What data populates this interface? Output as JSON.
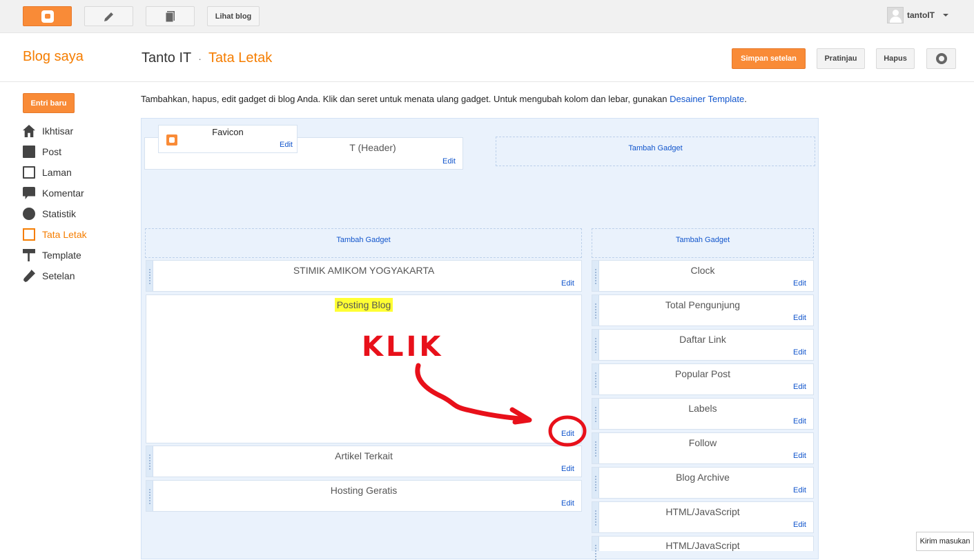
{
  "topbar": {
    "view_blog": "Lihat blog",
    "user_name": "tantoIT",
    "icons": [
      "blogger-logo-icon",
      "pencil-icon",
      "pages-icon",
      "avatar-icon",
      "caret-down-icon"
    ]
  },
  "header": {
    "my_blog": "Blog saya",
    "blog_name": "Tanto IT",
    "separator": "·",
    "section": "Tata Letak",
    "save_btn": "Simpan setelan",
    "preview_btn": "Pratinjau",
    "delete_btn": "Hapus"
  },
  "sidebar": {
    "new_post": "Entri baru",
    "items": [
      {
        "label": "Ikhtisar",
        "icon": "home-icon"
      },
      {
        "label": "Post",
        "icon": "post-icon"
      },
      {
        "label": "Laman",
        "icon": "page-icon"
      },
      {
        "label": "Komentar",
        "icon": "comment-icon"
      },
      {
        "label": "Statistik",
        "icon": "stats-icon"
      },
      {
        "label": "Tata Letak",
        "icon": "layout-icon",
        "active": true
      },
      {
        "label": "Template",
        "icon": "template-icon"
      },
      {
        "label": "Setelan",
        "icon": "settings-icon"
      }
    ]
  },
  "main": {
    "intro": "Tambahkan, hapus, edit gadget di blog Anda. Klik dan seret untuk menata ulang gadget. Untuk mengubah kolom dan lebar, gunakan ",
    "intro_link": "Desainer Template",
    "intro_end": ".",
    "edit": "Edit",
    "add_gadget": "Tambah Gadget",
    "favicon_title": "Favicon",
    "header_gadget": "T (Header)",
    "main_gadgets": [
      "STIMIK AMIKOM YOGYAKARTA",
      "Posting Blog",
      "Artikel Terkait",
      "Hosting Geratis"
    ],
    "side_gadgets": [
      "Clock",
      "Total Pengunjung",
      "Daftar Link",
      "Popular Post",
      "Labels",
      "Follow",
      "Blog Archive",
      "HTML/JavaScript",
      "HTML/JavaScript"
    ],
    "annotation": "KLIK"
  },
  "feedback": "Kirim masukan",
  "colors": {
    "accent": "#f98b37",
    "link": "#1155cc",
    "annotation": "#e8101a",
    "highlight": "#ffff33"
  }
}
